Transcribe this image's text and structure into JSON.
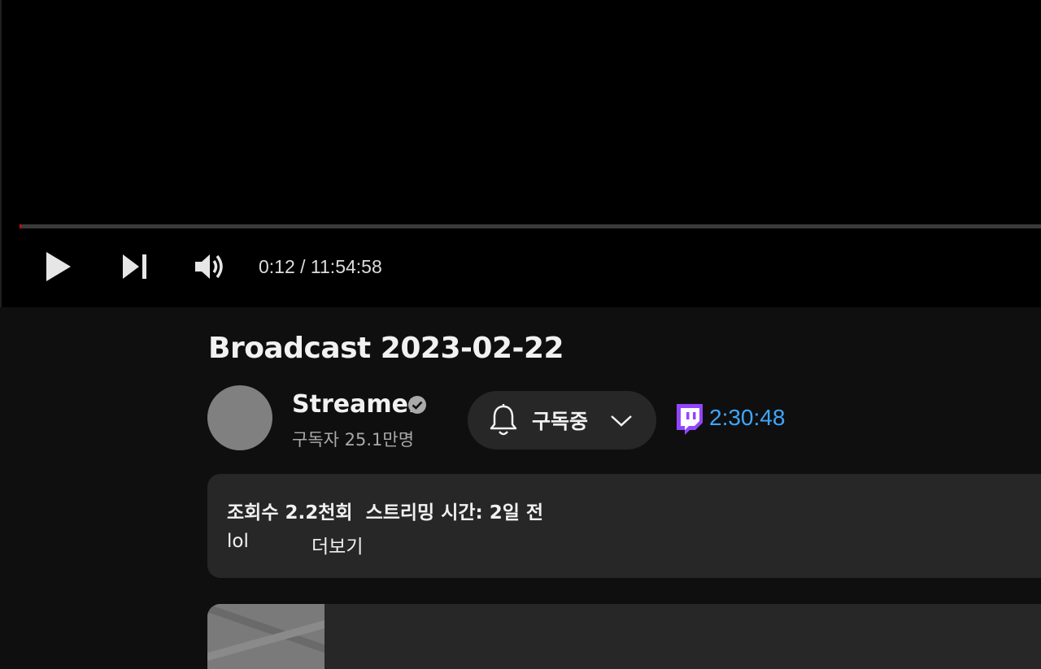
{
  "player": {
    "progress_fraction": 0.0003,
    "time_display": "0:12 / 11:54:58",
    "icons": {
      "play": "play-icon",
      "next": "next-track-icon",
      "volume": "volume-icon"
    }
  },
  "video": {
    "title": "Broadcast 2023-02-22"
  },
  "channel": {
    "name": "Streamer",
    "subscribers": "구독자 25.1만명",
    "verified_icon": "verified-check-icon"
  },
  "subscribe_button": {
    "label": "구독중",
    "bell_icon": "bell-icon",
    "chevron_icon": "chevron-down-icon"
  },
  "twitch": {
    "timestamp": "2:30:48",
    "icon": "twitch-icon",
    "color": "#3ea6ff",
    "brand_color": "#9146ff"
  },
  "description": {
    "meta": "조회수 2.2천회  스트리밍 시간: 2일 전",
    "text": "lol",
    "more_label": "더보기"
  },
  "colors": {
    "background": "#0f0f0f",
    "surface": "#272727",
    "progress": "#ff0000"
  }
}
